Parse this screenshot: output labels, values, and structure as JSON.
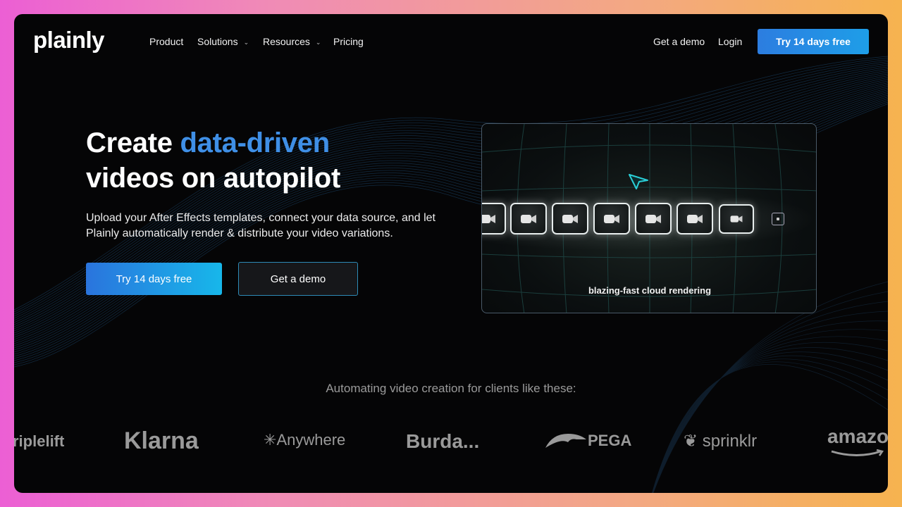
{
  "brand": {
    "name": "plainly"
  },
  "nav": {
    "items": [
      {
        "label": "Product"
      },
      {
        "label": "Solutions"
      },
      {
        "label": "Resources"
      },
      {
        "label": "Pricing"
      }
    ],
    "get_demo": "Get a demo",
    "login": "Login",
    "cta": "Try 14 days free"
  },
  "hero": {
    "title_pre": "Create ",
    "title_accent": "data-driven",
    "title_line2": "videos on autopilot",
    "subtitle": "Upload your After Effects templates, connect your data source, and let Plainly automatically render & distribute your video variations.",
    "primary_cta": "Try 14 days free",
    "secondary_cta": "Get a demo"
  },
  "panel": {
    "caption": "blazing-fast cloud rendering",
    "icons": [
      "video-camera-icon",
      "cursor-arrow-icon",
      "stop-icon"
    ]
  },
  "clients": {
    "heading": "Automating video creation for clients like these:",
    "logos": [
      "riplelift",
      "Klarna",
      "Anywhere",
      "Burda...",
      "PEGA",
      "sprinklr",
      "amazo"
    ]
  },
  "colors": {
    "accent": "#3f8fe6",
    "cta_start": "#2a74dd",
    "cta_end": "#17b7ea",
    "background": "#050506"
  }
}
